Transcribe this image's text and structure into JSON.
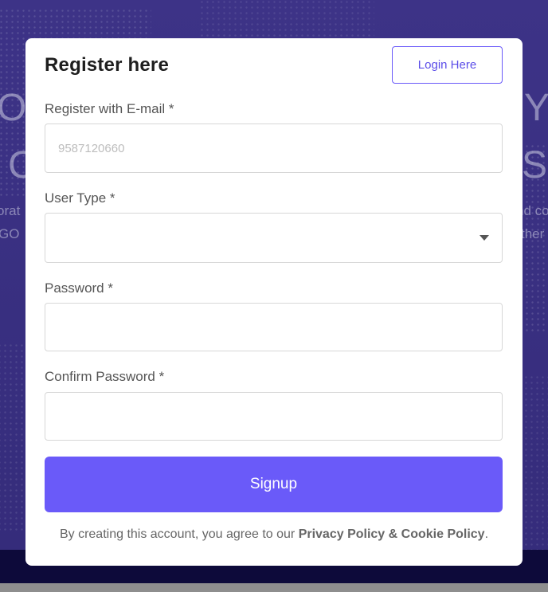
{
  "background": {
    "headline_left_1": "O.",
    "headline_left_2": "C",
    "headline_right_1": "SY",
    "headline_right_2": "S",
    "body_left_1": "orat",
    "body_left_2": "GO",
    "body_right_1": "nd co",
    "body_right_2": "ther"
  },
  "modal": {
    "title": "Register here",
    "login_button": "Login Here",
    "email": {
      "label": "Register with E-mail *",
      "placeholder": "9587120660",
      "value": ""
    },
    "user_type": {
      "label": "User Type *",
      "selected": ""
    },
    "password": {
      "label": "Password *",
      "value": ""
    },
    "confirm_password": {
      "label": "Confirm Password *",
      "value": ""
    },
    "signup_button": "Signup",
    "terms": {
      "prefix": "By creating this account, you agree to our ",
      "link": "Privacy Policy & Cookie Policy",
      "suffix": "."
    }
  },
  "colors": {
    "accent": "#6a5af9",
    "backdrop": "#3a3183",
    "footer": "#0d0a3a"
  }
}
